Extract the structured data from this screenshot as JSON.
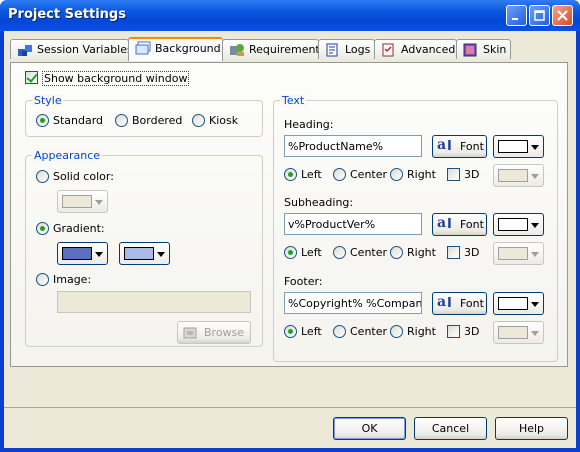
{
  "window": {
    "title": "Project Settings"
  },
  "tabs": [
    "Session Variables",
    "Background",
    "Requirements",
    "Logs",
    "Advanced",
    "Skin"
  ],
  "show_bg_label": "Show background window",
  "style_group": {
    "title": "Style",
    "options": [
      "Standard",
      "Bordered",
      "Kiosk"
    ],
    "selected": "Standard"
  },
  "appearance": {
    "title": "Appearance",
    "solid_label": "Solid color:",
    "gradient_label": "Gradient:",
    "image_label": "Image:",
    "browse_label": "Browse",
    "selected": "Gradient",
    "gradient_color1": "#5b6fbd",
    "gradient_color2": "#aab9e6",
    "solid_color": "#ece9d8"
  },
  "text_group": {
    "title": "Text",
    "heading": {
      "label": "Heading:",
      "value": "%ProductName%",
      "font_label": "Font",
      "align": "Left"
    },
    "subheading": {
      "label": "Subheading:",
      "value": "v%ProductVer%",
      "font_label": "Font",
      "align": "Left"
    },
    "footer": {
      "label": "Footer:",
      "value": "%Copyright% %CompanyNa",
      "font_label": "Font",
      "align": "Left"
    },
    "align_options": [
      "Left",
      "Center",
      "Right"
    ],
    "three_d_label": "3D"
  },
  "buttons": {
    "ok": "OK",
    "cancel": "Cancel",
    "help": "Help"
  }
}
